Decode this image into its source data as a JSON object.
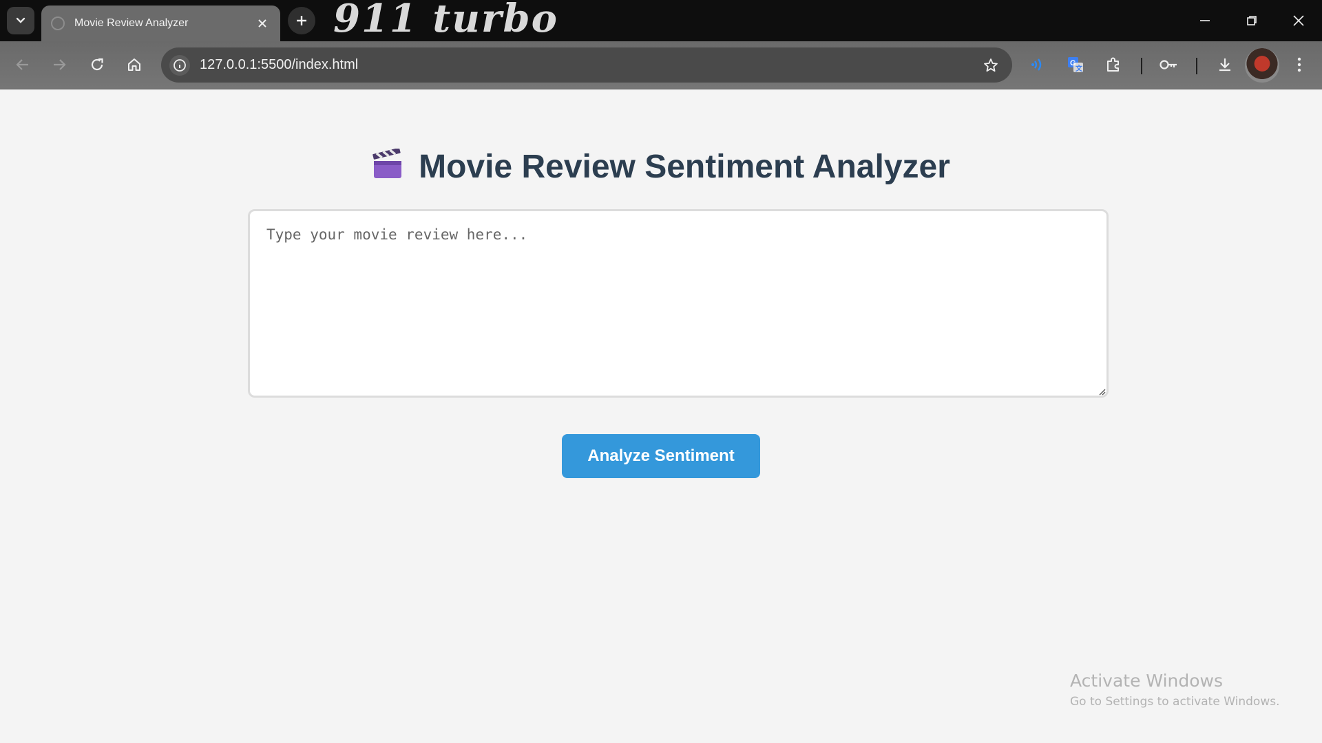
{
  "browser": {
    "tab": {
      "title": "Movie Review Analyzer"
    },
    "theme_logo_text": "911 turbo",
    "address_bar": {
      "url": "127.0.0.1:5500/index.html"
    },
    "icons": [
      "tab-search-icon",
      "close-icon",
      "plus-icon",
      "minimize-icon",
      "restore-icon",
      "window-close-icon",
      "back-arrow-icon",
      "forward-arrow-icon",
      "reload-icon",
      "home-icon",
      "info-icon",
      "star-icon",
      "read-aloud-icon",
      "translate-icon",
      "extensions-icon",
      "password-key-icon",
      "download-icon",
      "profile-avatar",
      "kebab-menu-icon"
    ]
  },
  "page": {
    "heading_emoji": "🎬",
    "heading": "Movie Review Sentiment Analyzer",
    "review_input": {
      "placeholder": "Type your movie review here...",
      "value": ""
    },
    "analyze_button": "Analyze Sentiment"
  },
  "watermark": {
    "line1": "Activate Windows",
    "line2": "Go to Settings to activate Windows."
  },
  "colors": {
    "heading": "#2c3e50",
    "button": "#3498db",
    "page_bg": "#f4f4f4"
  }
}
